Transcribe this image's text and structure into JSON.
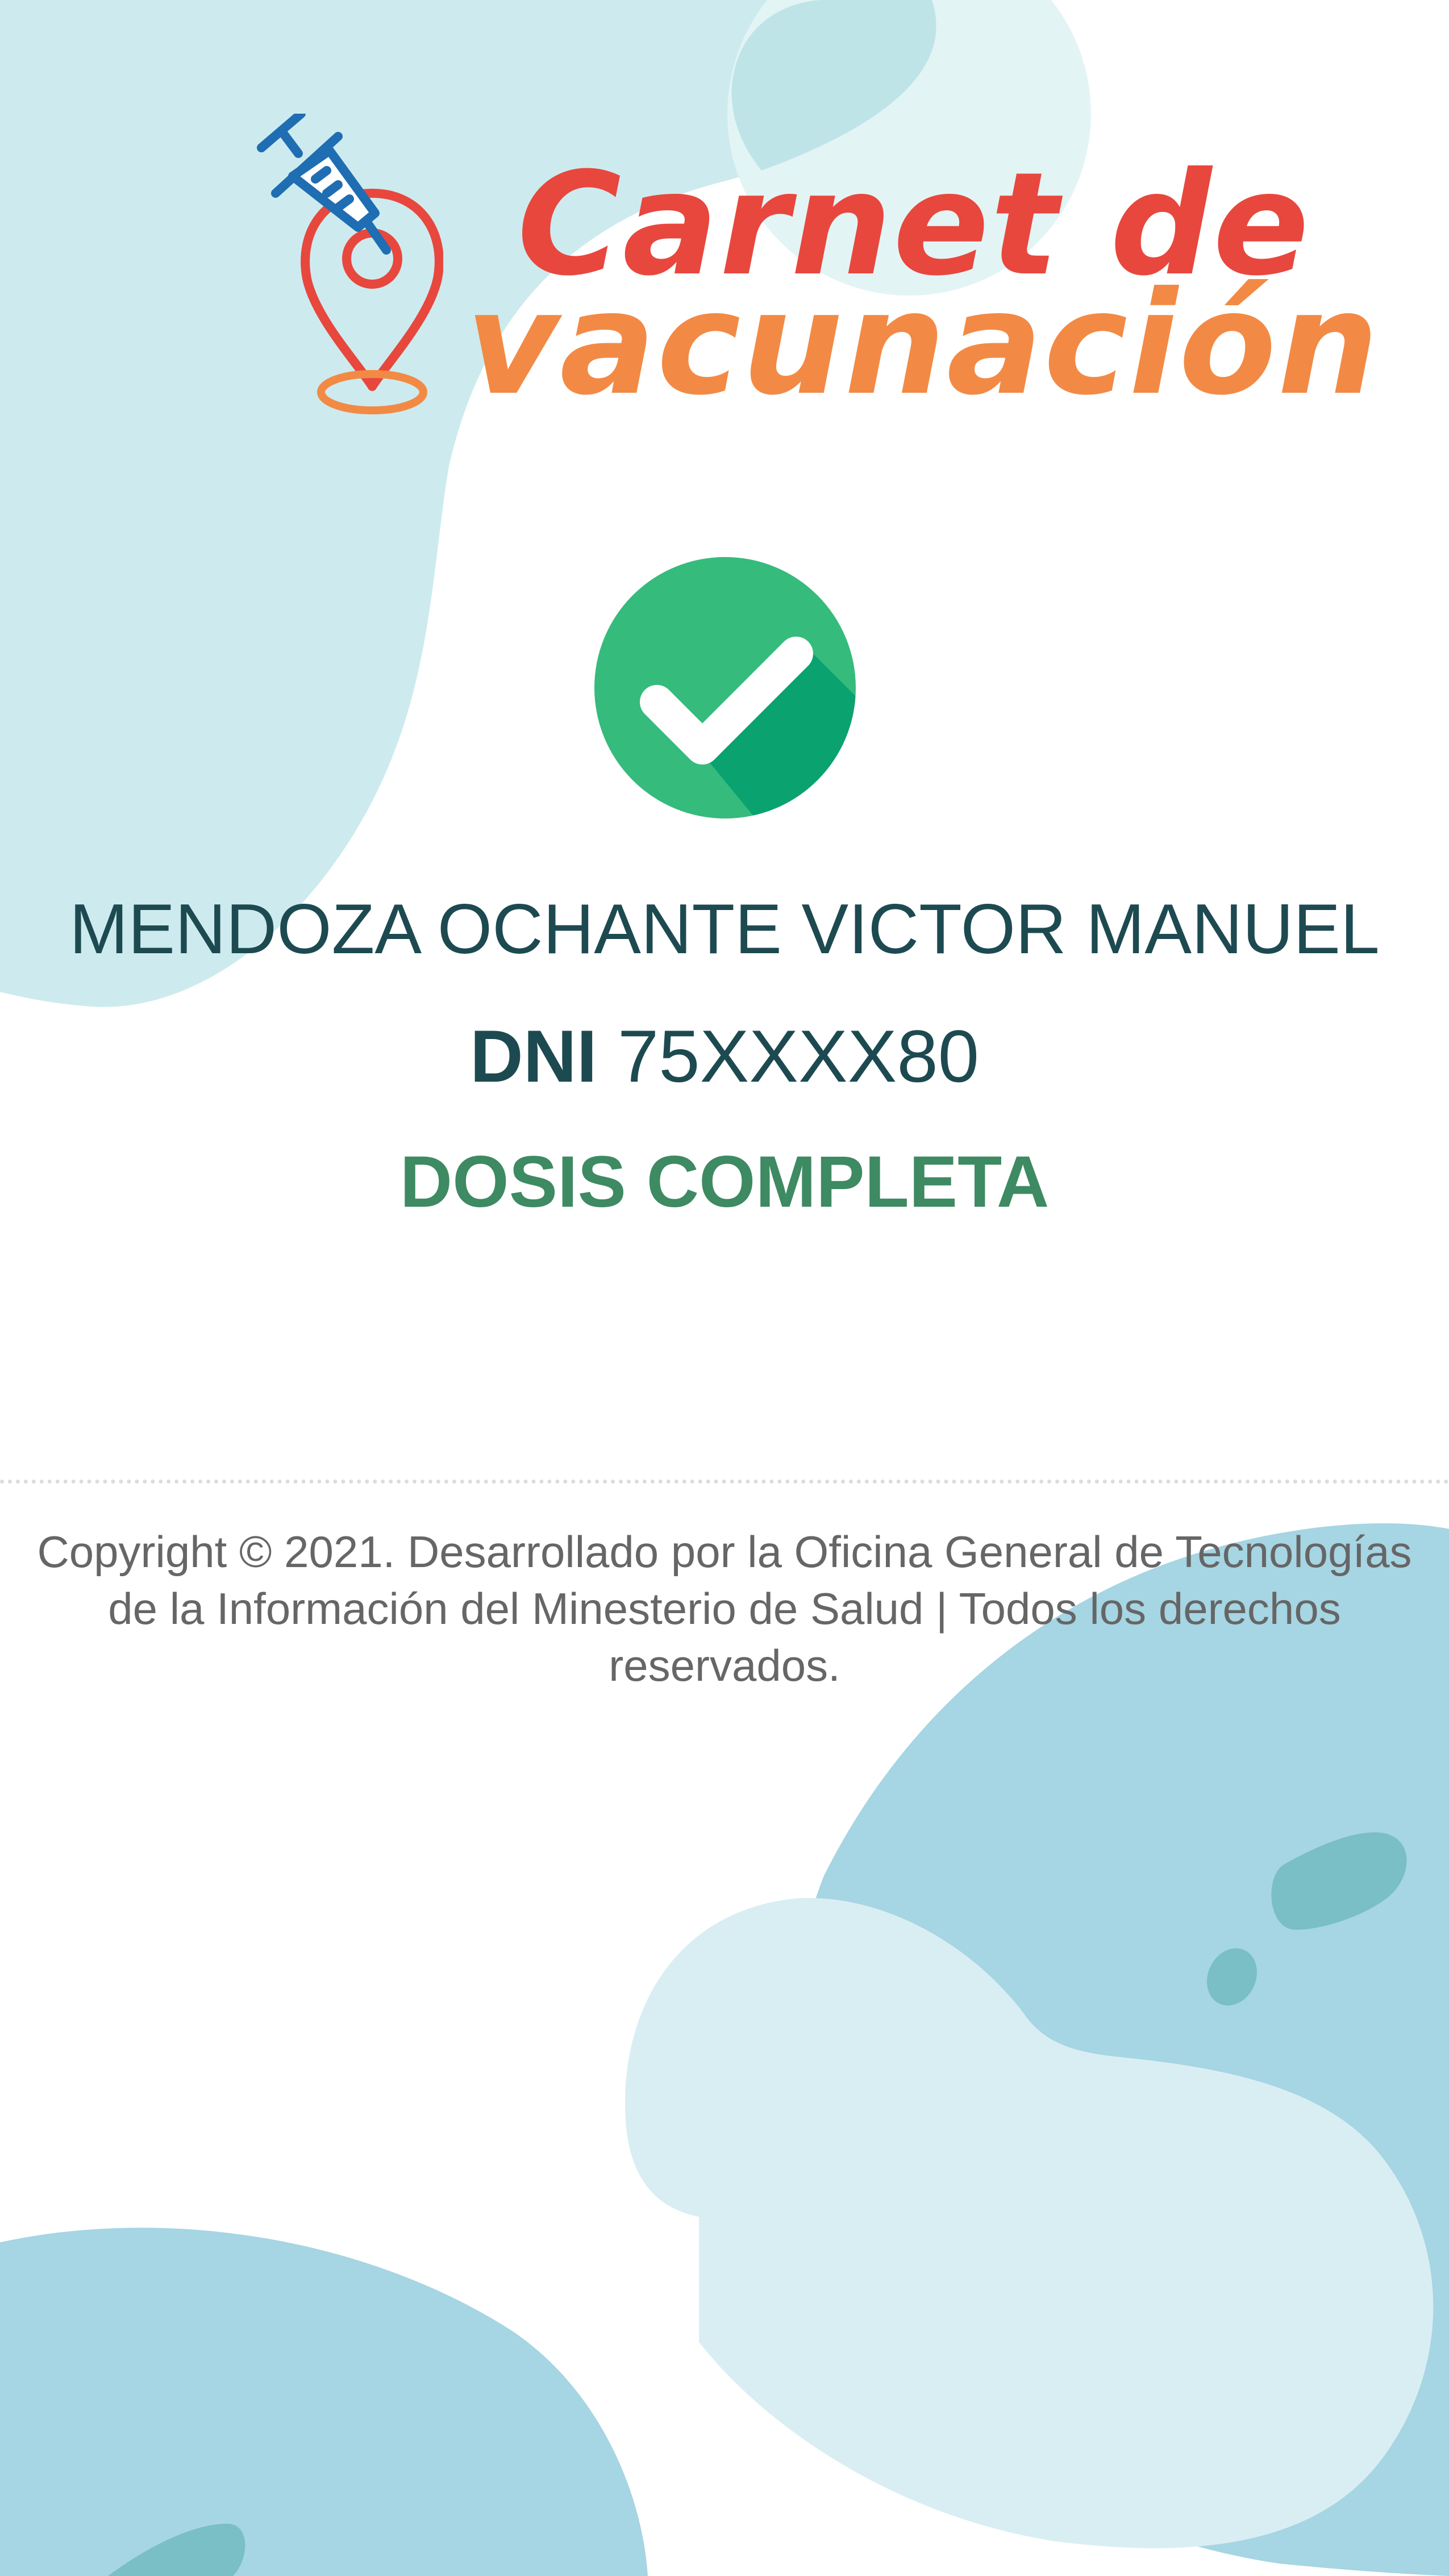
{
  "header": {
    "title_line1": "Carnet de",
    "title_line2": "vacunación",
    "logo_icon": "syringe-location-pin-icon"
  },
  "status": {
    "icon": "check-circle-icon",
    "name": "MENDOZA OCHANTE VICTOR MANUEL",
    "dni_label": "DNI",
    "dni_value": "75XXXX80",
    "dose_status": "DOSIS COMPLETA"
  },
  "footer": {
    "copyright": "Copyright © 2021. Desarrollado por la Oficina General de Tecnologías de la Información del Minesterio de Salud | Todos los derechos reservados."
  },
  "colors": {
    "title_red": "#e8473e",
    "title_orange": "#f28a45",
    "icon_blue": "#1f6db3",
    "check_green": "#35bb7c",
    "check_shadow": "#0aa26f",
    "name_text": "#1d4a50",
    "dose_green": "#3e8a62",
    "footer_text": "#666666",
    "blob_light": "#cdebee",
    "blob_pale": "#e3f4f5",
    "blob_medium": "#a6d5e3",
    "blob_pale_blue": "#d9eef3",
    "blob_spot": "#79bfc5"
  }
}
